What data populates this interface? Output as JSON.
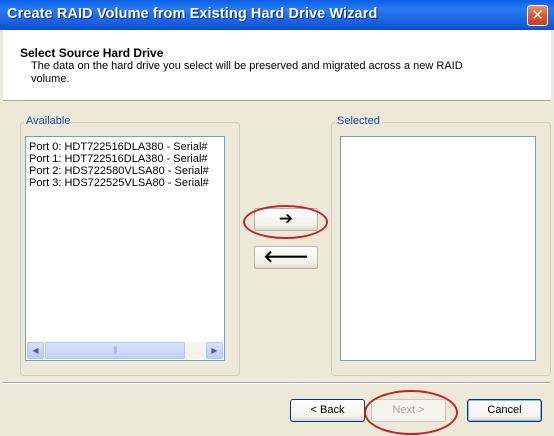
{
  "window": {
    "title": "Create RAID Volume from Existing Hard Drive Wizard",
    "close_glyph": "✕"
  },
  "header": {
    "title": "Select Source Hard Drive",
    "description": "The data on the hard drive you select will be preserved and migrated across a new RAID volume."
  },
  "available": {
    "label": "Available",
    "items": [
      "Port 0: HDT722516DLA380 - Serial#",
      "Port 1: HDT722516DLA380 - Serial#",
      "Port 2: HDS722580VLSA80 - Serial#",
      "Port 3: HDS722525VLSA80 - Serial#"
    ],
    "scroll_left_glyph": "◀",
    "scroll_right_glyph": "▶",
    "thumb_grip": "|||"
  },
  "selected": {
    "label": "Selected",
    "items": []
  },
  "transfer": {
    "add_glyph": "➔",
    "remove_glyph": "🡐"
  },
  "buttons": {
    "back_label": "< Back",
    "next_label": "Next >",
    "cancel_label": "Cancel"
  },
  "annotations": {
    "callout_color": "#c8202a"
  }
}
